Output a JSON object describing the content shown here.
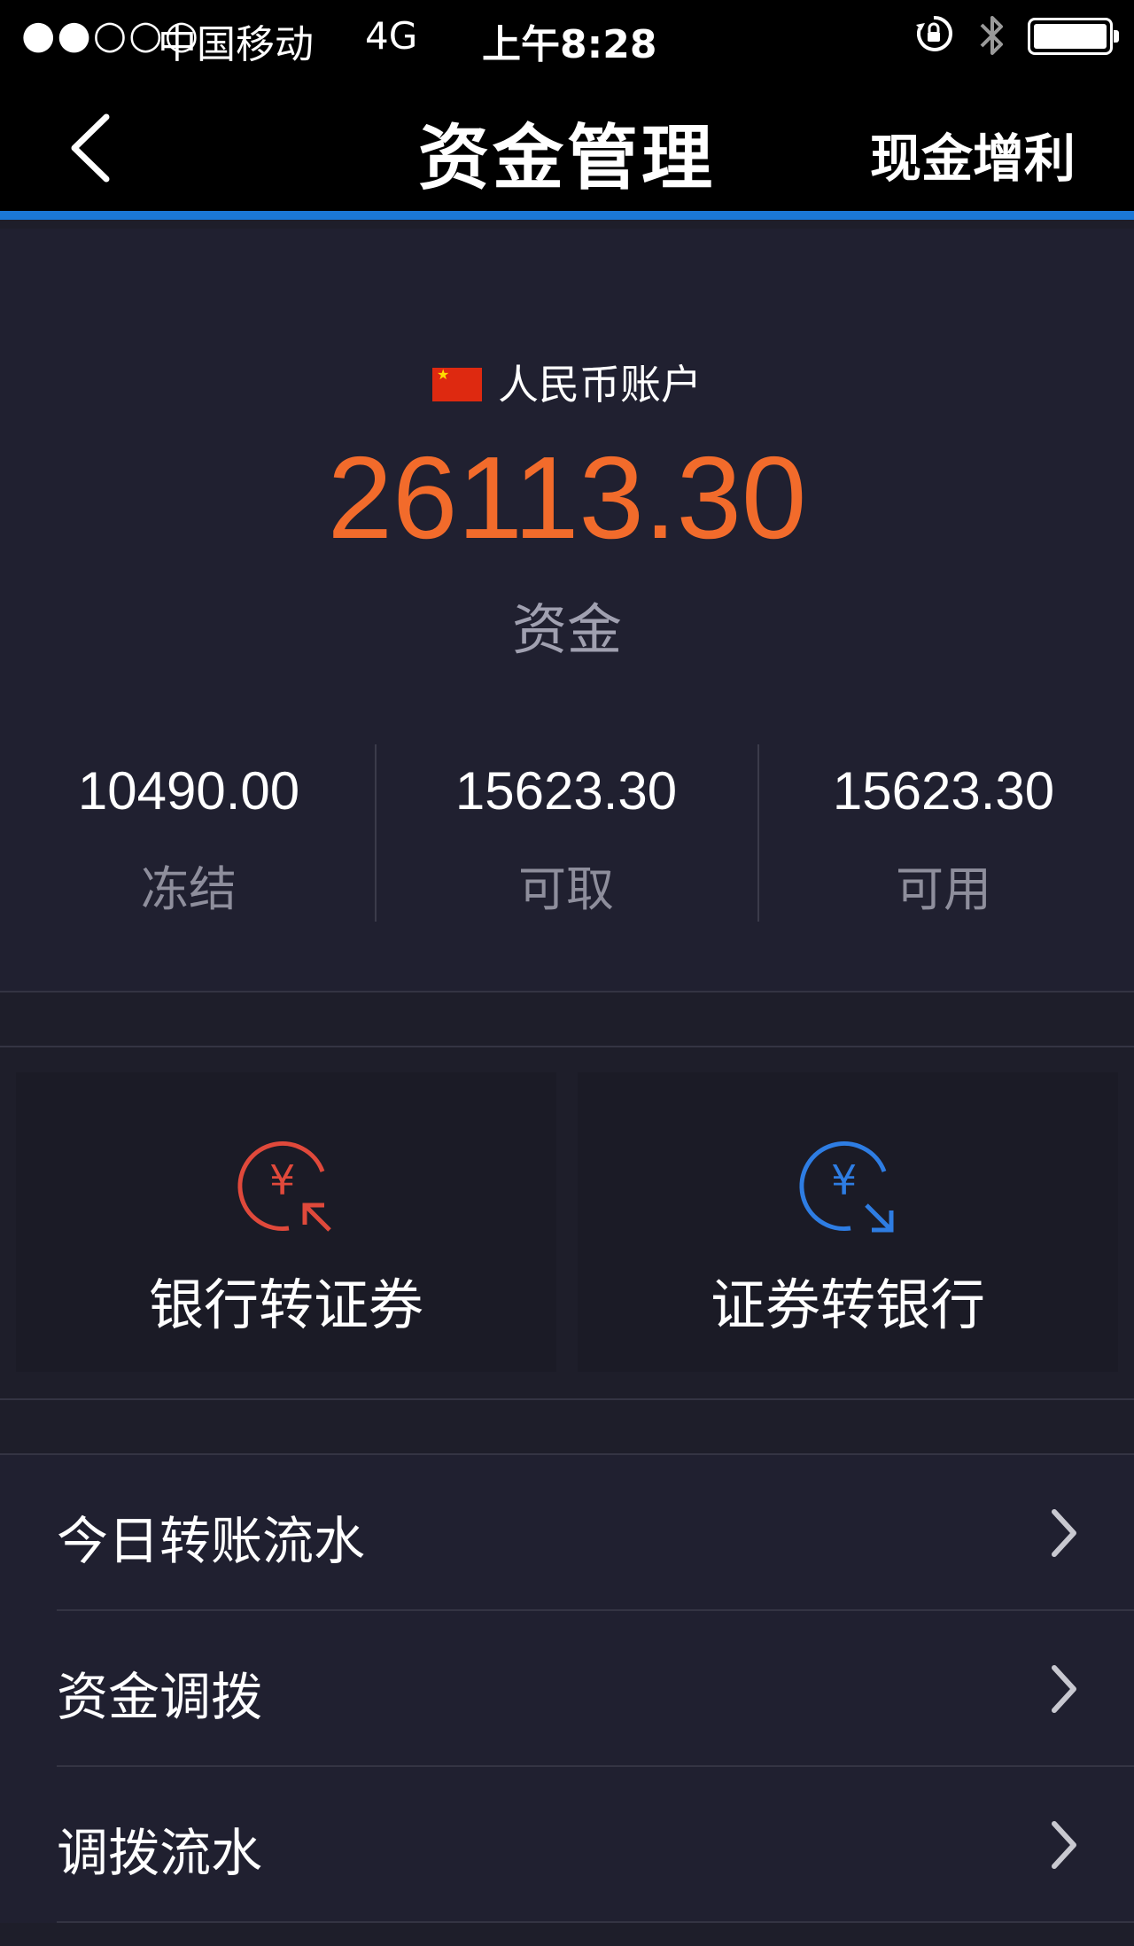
{
  "status_bar": {
    "signal": "●●○○○",
    "carrier": "中国移动",
    "network": "4G",
    "time": "上午8:28"
  },
  "nav": {
    "title": "资金管理",
    "right_action": "现金增利"
  },
  "account": {
    "name": "人民币账户",
    "total": "26113.30",
    "total_label": "资金",
    "stats": [
      {
        "value": "10490.00",
        "label": "冻结"
      },
      {
        "value": "15623.30",
        "label": "可取"
      },
      {
        "value": "15623.30",
        "label": "可用"
      }
    ]
  },
  "actions": [
    {
      "label": "银行转证券",
      "color": "#e0493b"
    },
    {
      "label": "证券转银行",
      "color": "#2e7de3"
    }
  ],
  "menu": [
    {
      "label": "今日转账流水"
    },
    {
      "label": "资金调拨"
    },
    {
      "label": "调拨流水"
    }
  ],
  "colors": {
    "accent": "#1b78d6",
    "total": "#f26b2b"
  }
}
